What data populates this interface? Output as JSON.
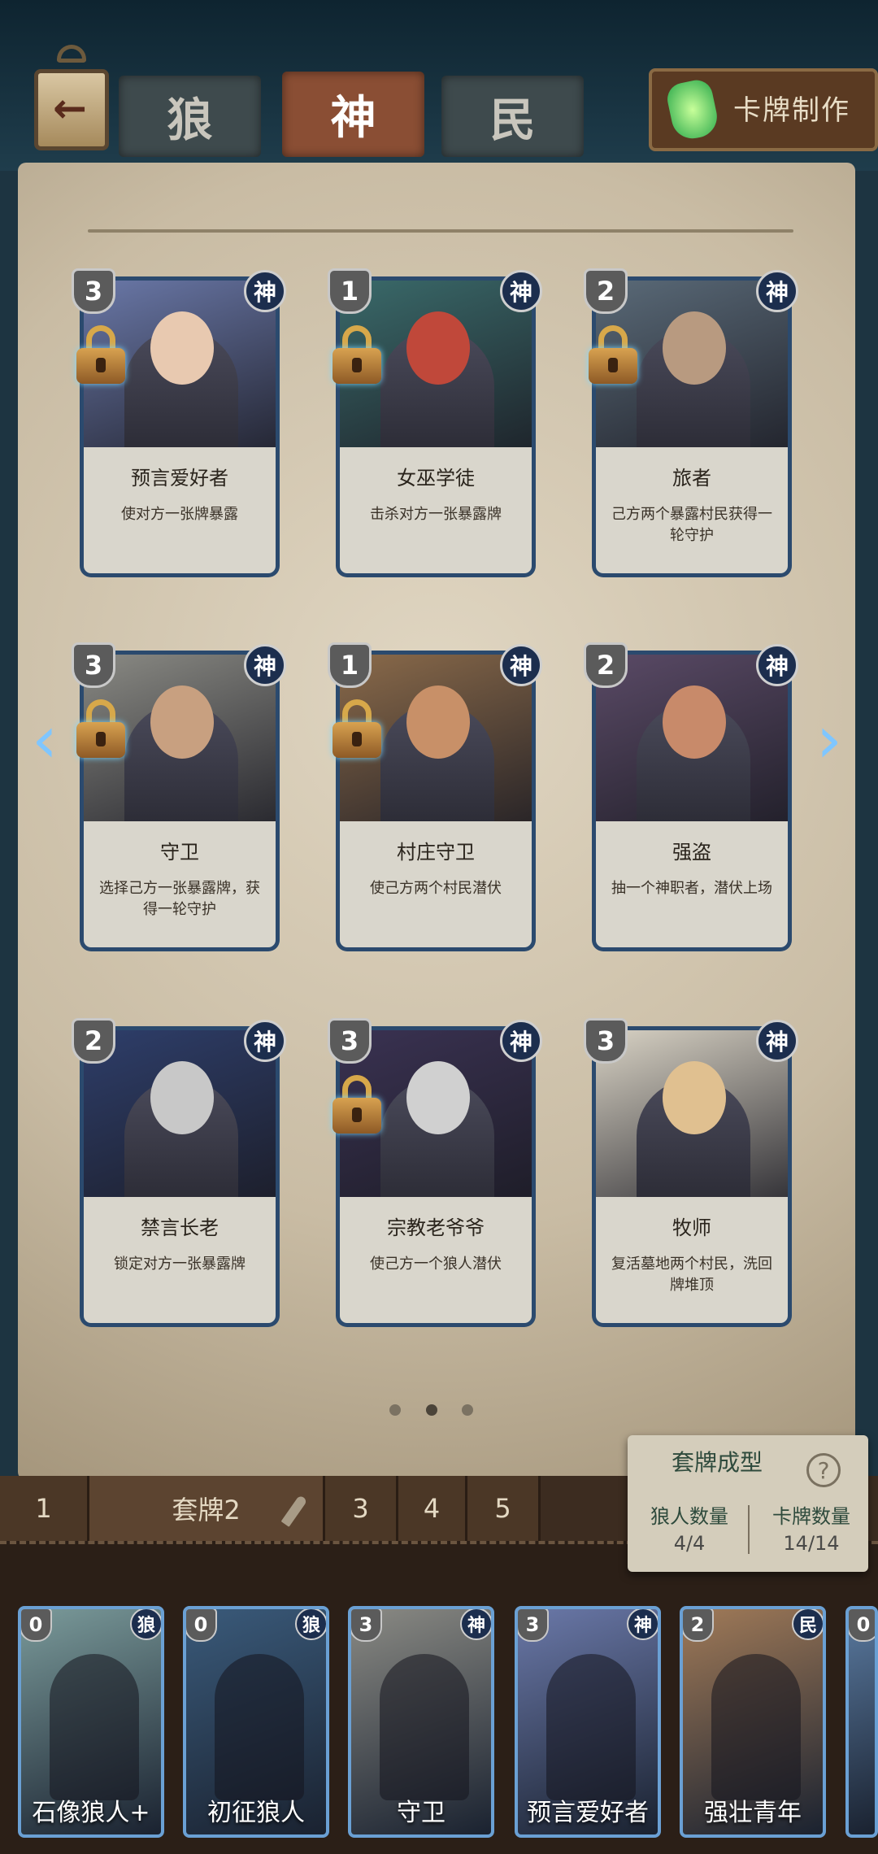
{
  "tabs": [
    "狼",
    "神",
    "民"
  ],
  "active_tab": 1,
  "craft_label": "卡牌制作",
  "cards": [
    {
      "cost": "3",
      "faction": "神",
      "name": "预言爱好者",
      "desc": "使对方一张牌暴露",
      "locked": true,
      "art": "#6a78a8",
      "skin": "#e8c9b0"
    },
    {
      "cost": "1",
      "faction": "神",
      "name": "女巫学徒",
      "desc": "击杀对方一张暴露牌",
      "locked": true,
      "art": "#3a6a6a",
      "skin": "#c0483a"
    },
    {
      "cost": "2",
      "faction": "神",
      "name": "旅者",
      "desc": "己方两个暴露村民获得一轮守护",
      "locked": true,
      "art": "#5a6a78",
      "skin": "#b89a80"
    },
    {
      "cost": "3",
      "faction": "神",
      "name": "守卫",
      "desc": "选择己方一张暴露牌，获得一轮守护",
      "locked": true,
      "art": "#8a8a84",
      "skin": "#c8a080"
    },
    {
      "cost": "1",
      "faction": "神",
      "name": "村庄守卫",
      "desc": "使己方两个村民潜伏",
      "locked": true,
      "art": "#8a6a4a",
      "skin": "#c89068"
    },
    {
      "cost": "2",
      "faction": "神",
      "name": "强盗",
      "desc": "抽一个神职者，潜伏上场",
      "locked": false,
      "art": "#5a4a66",
      "skin": "#c88a6a"
    },
    {
      "cost": "2",
      "faction": "神",
      "name": "禁言长老",
      "desc": "锁定对方一张暴露牌",
      "locked": false,
      "art": "#2e3e6a",
      "skin": "#c8c8c8"
    },
    {
      "cost": "3",
      "faction": "神",
      "name": "宗教老爷爷",
      "desc": "使己方一个狼人潜伏",
      "locked": true,
      "art": "#3a3252",
      "skin": "#d0d0d0"
    },
    {
      "cost": "3",
      "faction": "神",
      "name": "牧师",
      "desc": "复活墓地两个村民，洗回牌堆顶",
      "locked": false,
      "art": "#d8d2c4",
      "skin": "#e0c090"
    }
  ],
  "deck_tabs": [
    "1",
    "套牌2",
    "3",
    "4",
    "5"
  ],
  "summary": {
    "title": "套牌成型",
    "help": "?",
    "wolf_label": "狼人数量",
    "wolf_value": "4/4",
    "card_label": "卡牌数量",
    "card_value": "14/14"
  },
  "deck_cards": [
    {
      "cost": "0",
      "faction": "狼",
      "name": "石像狼人+",
      "color": "#7a9a9a"
    },
    {
      "cost": "0",
      "faction": "狼",
      "name": "初征狼人",
      "color": "#3a5a7a"
    },
    {
      "cost": "3",
      "faction": "神",
      "name": "守卫",
      "color": "#8a8a84"
    },
    {
      "cost": "3",
      "faction": "神",
      "name": "预言爱好者",
      "color": "#6a78a8"
    },
    {
      "cost": "2",
      "faction": "民",
      "name": "强壮青年",
      "color": "#a07a58"
    }
  ],
  "partial_card": {
    "cost": "0"
  }
}
